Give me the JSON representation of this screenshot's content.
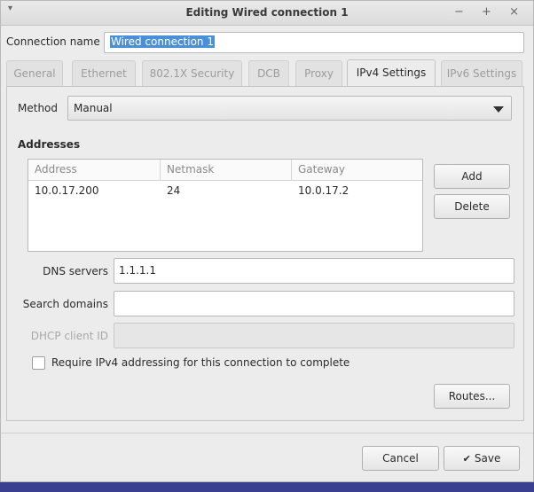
{
  "window": {
    "title": "Editing Wired connection 1",
    "menu_glyph": "▾",
    "minimize_glyph": "−",
    "maximize_glyph": "+",
    "close_glyph": "×"
  },
  "connection": {
    "label": "Connection name",
    "value": "Wired connection 1"
  },
  "tabs": [
    {
      "label": "General",
      "active": false
    },
    {
      "label": "Ethernet",
      "active": false
    },
    {
      "label": "802.1X Security",
      "active": false
    },
    {
      "label": "DCB",
      "active": false
    },
    {
      "label": "Proxy",
      "active": false
    },
    {
      "label": "IPv4 Settings",
      "active": true
    },
    {
      "label": "IPv6 Settings",
      "active": false
    }
  ],
  "ipv4": {
    "method_label": "Method",
    "method_value": "Manual",
    "addresses_heading": "Addresses",
    "columns": [
      "Address",
      "Netmask",
      "Gateway"
    ],
    "rows": [
      [
        "10.0.17.200",
        "24",
        "10.0.17.2"
      ]
    ],
    "add_label": "Add",
    "delete_label": "Delete",
    "dns_label": "DNS servers",
    "dns_value": "1.1.1.1",
    "search_label": "Search domains",
    "search_value": "",
    "dhcp_label": "DHCP client ID",
    "dhcp_value": "",
    "require_label": "Require IPv4 addressing for this connection to complete",
    "require_checked": false,
    "routes_label": "Routes..."
  },
  "footer": {
    "cancel_label": "Cancel",
    "save_label": "Save",
    "save_icon": "✔"
  }
}
